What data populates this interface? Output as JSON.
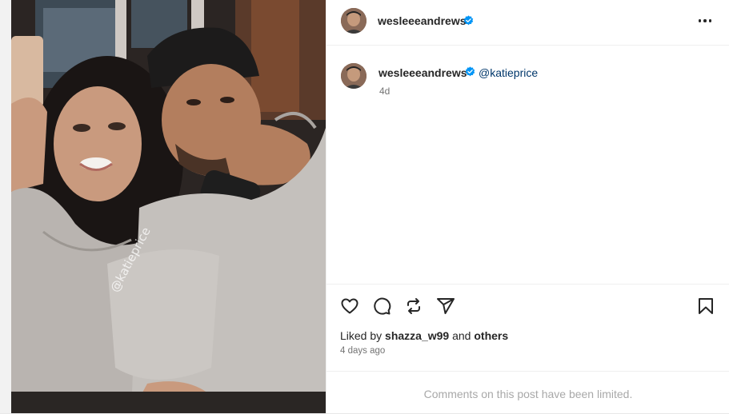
{
  "post": {
    "author": "wesleeeandrews",
    "caption": {
      "author": "wesleeeandrews",
      "mention": "@katieprice",
      "age": "4d"
    },
    "photo": {
      "watermark": "@katieprice"
    },
    "likes": {
      "prefix": "Liked by",
      "user": "shazza_w99",
      "joiner": "and",
      "others": "others"
    },
    "timestamp": "4 days ago",
    "comments_notice": "Comments on this post have been limited."
  },
  "colors": {
    "verified": "#0095f6",
    "mention": "#00376b",
    "muted": "#737373"
  },
  "icons": {
    "more": "more-options-icon",
    "like": "heart-icon",
    "comment": "comment-icon",
    "repost": "repost-icon",
    "share": "share-icon",
    "save": "bookmark-icon"
  }
}
